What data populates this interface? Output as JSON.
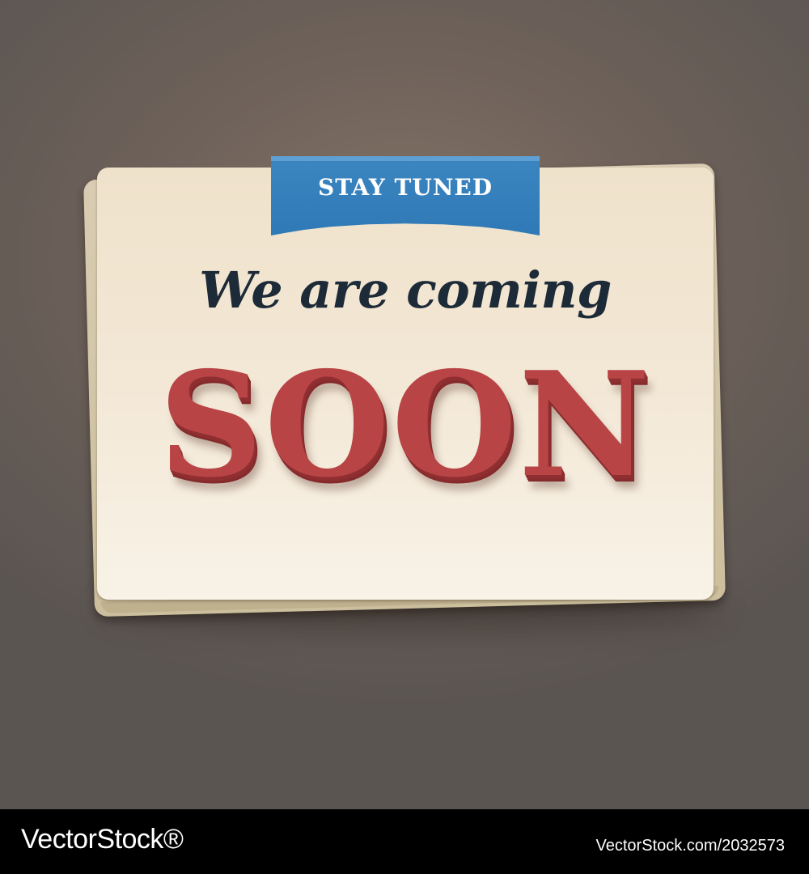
{
  "sign": {
    "ribbon_label": "STAY TUNED",
    "headline": "We are coming",
    "big_word": "SOON"
  },
  "footer": {
    "logo_text": "VectorStock®",
    "image_id": "VectorStock.com/2032573"
  },
  "colors": {
    "background": "#6f625a",
    "card": "#f3e8d6",
    "ribbon": "#3380bc",
    "headline": "#1d2a37",
    "big_word": "#b84445",
    "footer": "#000000"
  }
}
